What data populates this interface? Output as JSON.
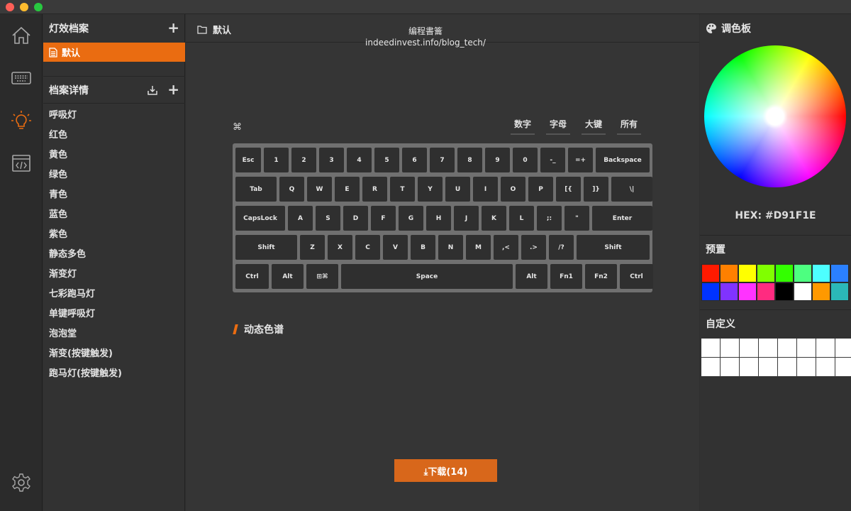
{
  "watermark": {
    "line1": "编程書籥",
    "line2": "indeedinvest.info/blog_tech/"
  },
  "sidebar": {
    "profiles_title": "灯效档案",
    "active_profile": "默认",
    "details_title": "档案详情",
    "effects": [
      "呼吸灯",
      "红色",
      "黄色",
      "绿色",
      "青色",
      "蓝色",
      "紫色",
      "静态多色",
      "渐变灯",
      "七彩跑马灯",
      "单键呼吸灯",
      "泡泡堂",
      "渐变(按键触发)",
      "跑马灯(按键触发)"
    ]
  },
  "main": {
    "breadcrumb": "默认",
    "cmd_glyph": "⌘",
    "filter_tabs": [
      "数字",
      "字母",
      "大键",
      "所有"
    ],
    "keyboard_rows": [
      [
        "Esc",
        "1",
        "2",
        "3",
        "4",
        "5",
        "6",
        "7",
        "8",
        "9",
        "0",
        "-_",
        "=+",
        "Backspace"
      ],
      [
        "Tab",
        "Q",
        "W",
        "E",
        "R",
        "T",
        "Y",
        "U",
        "I",
        "O",
        "P",
        "[{",
        "]}",
        "\\|"
      ],
      [
        "CapsLock",
        "A",
        "S",
        "D",
        "F",
        "G",
        "H",
        "J",
        "K",
        "L",
        ";:",
        "\"",
        "Enter"
      ],
      [
        "Shift",
        "Z",
        "X",
        "C",
        "V",
        "B",
        "N",
        "M",
        ",<",
        ".>",
        "/?",
        "Shift"
      ],
      [
        "Ctrl",
        "Alt",
        "⊞⌘",
        "Space",
        "Alt",
        "Fn1",
        "Fn2",
        "Ctrl"
      ]
    ],
    "section_title": "动态色谱",
    "download_label": "⤓下载(14)"
  },
  "palette": {
    "title": "调色板",
    "hex_label": "HEX: #D91F1E",
    "presets_title": "预置",
    "presets": [
      "#ff1a00",
      "#ff8000",
      "#ffff00",
      "#80ff00",
      "#33ff00",
      "#4dff80",
      "#4dffff",
      "#2b80ff",
      "#0033ff",
      "#8033ff",
      "#ff33ff",
      "#ff2b80",
      "#000000",
      "#ffffff",
      "#ff9900",
      "#2bb8b8"
    ],
    "custom_title": "自定义",
    "custom_cells": 16
  },
  "colors": {
    "accent": "#ea6c11",
    "download": "#d8671b",
    "keyboard_frame": "#707070",
    "key": "#2f2f2f"
  },
  "icons": {
    "rail": [
      "home-icon",
      "keyboard-icon",
      "lightbulb-icon",
      "code-window-icon",
      "gear-icon"
    ]
  }
}
